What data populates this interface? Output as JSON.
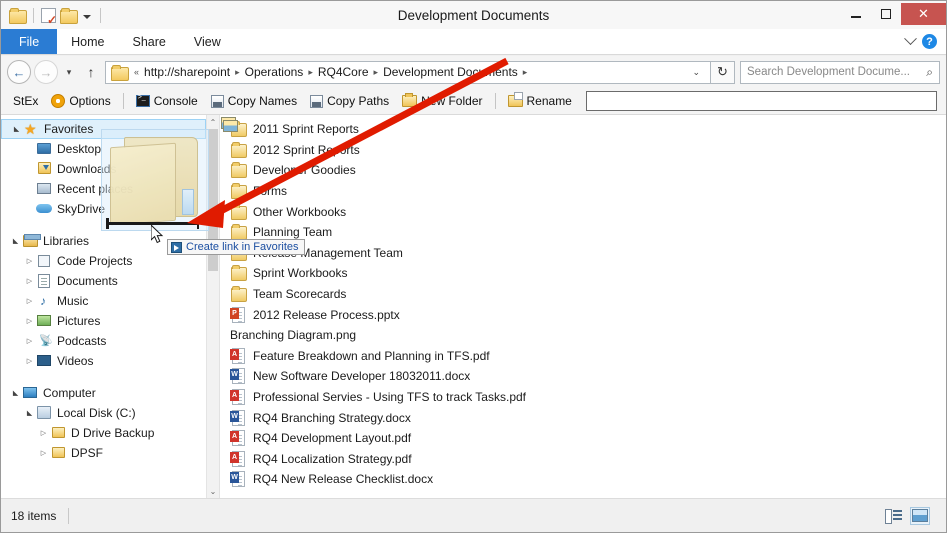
{
  "window": {
    "title": "Development Documents",
    "minimize_label": "Minimize",
    "maximize_label": "Maximize",
    "close_label": "✕"
  },
  "quick_access": {
    "folder_icon": "folder-icon",
    "properties_icon": "properties-icon",
    "new_folder_icon": "new-folder-icon",
    "dropdown_icon": "chevron-down-icon"
  },
  "ribbon": {
    "tabs": [
      {
        "label": "File",
        "active": true
      },
      {
        "label": "Home",
        "active": false
      },
      {
        "label": "Share",
        "active": false
      },
      {
        "label": "View",
        "active": false
      }
    ],
    "expand_icon": "chevron-down-icon",
    "help_icon": "help-icon",
    "help_glyph": "?"
  },
  "address_bar": {
    "back_glyph": "←",
    "forward_glyph": "→",
    "history_glyph": "▾",
    "up_glyph": "↑",
    "folder_icon": "folder-icon",
    "prefix": "«",
    "breadcrumbs": [
      "http://sharepoint",
      "Operations",
      "RQ4Core",
      "Development Documents"
    ],
    "separator": "▸",
    "dropdown_glyph": "⌄",
    "refresh_glyph": "↻"
  },
  "search": {
    "placeholder": "Search Development Docume...",
    "icon": "search-icon",
    "glyph": "⌕"
  },
  "toolbar": {
    "items": [
      {
        "label": "StEx",
        "icon": "none"
      },
      {
        "label": "Options",
        "icon": "gear-icon"
      },
      {
        "label": "Console",
        "icon": "console-icon"
      },
      {
        "label": "Copy Names",
        "icon": "copy-names-icon"
      },
      {
        "label": "Copy Paths",
        "icon": "copy-paths-icon"
      },
      {
        "label": "New Folder",
        "icon": "new-folder-icon"
      },
      {
        "label": "Rename",
        "icon": "rename-icon"
      }
    ],
    "input_value": "",
    "input_placeholder": ""
  },
  "sidebar": {
    "items": [
      {
        "label": "Favorites",
        "indent": 0,
        "expander": "open",
        "icon": "star-icon",
        "selected": true
      },
      {
        "label": "Desktop",
        "indent": 1,
        "expander": "none",
        "icon": "desktop-icon",
        "selected": false
      },
      {
        "label": "Downloads",
        "indent": 1,
        "expander": "none",
        "icon": "downloads-icon",
        "selected": false
      },
      {
        "label": "Recent places",
        "indent": 1,
        "expander": "none",
        "icon": "recent-places-icon",
        "selected": false
      },
      {
        "label": "SkyDrive",
        "indent": 1,
        "expander": "none",
        "icon": "skydrive-icon",
        "selected": false
      },
      {
        "label": "Libraries",
        "indent": 0,
        "expander": "open",
        "icon": "libraries-icon",
        "selected": false,
        "spacer_before": true
      },
      {
        "label": "Code Projects",
        "indent": 1,
        "expander": "closed",
        "icon": "code-projects-icon",
        "selected": false
      },
      {
        "label": "Documents",
        "indent": 1,
        "expander": "closed",
        "icon": "documents-icon",
        "selected": false
      },
      {
        "label": "Music",
        "indent": 1,
        "expander": "closed",
        "icon": "music-icon",
        "selected": false
      },
      {
        "label": "Pictures",
        "indent": 1,
        "expander": "closed",
        "icon": "pictures-icon",
        "selected": false
      },
      {
        "label": "Podcasts",
        "indent": 1,
        "expander": "closed",
        "icon": "podcasts-icon",
        "selected": false
      },
      {
        "label": "Videos",
        "indent": 1,
        "expander": "closed",
        "icon": "videos-icon",
        "selected": false
      },
      {
        "label": "Computer",
        "indent": 0,
        "expander": "open",
        "icon": "computer-icon",
        "selected": false,
        "spacer_before": true
      },
      {
        "label": "Local Disk (C:)",
        "indent": 1,
        "expander": "open",
        "icon": "disk-icon",
        "selected": false
      },
      {
        "label": "D Drive Backup",
        "indent": 2,
        "expander": "closed",
        "icon": "folder-icon",
        "selected": false
      },
      {
        "label": "DPSF",
        "indent": 2,
        "expander": "closed",
        "icon": "folder-icon",
        "selected": false
      }
    ],
    "scroll_up_glyph": "⌃",
    "scroll_down_glyph": "⌄"
  },
  "file_list": {
    "items": [
      {
        "name": "2011 Sprint Reports",
        "type": "folder"
      },
      {
        "name": "2012 Sprint Reports",
        "type": "folder"
      },
      {
        "name": "Developer Goodies",
        "type": "folder"
      },
      {
        "name": "Forms",
        "type": "folder"
      },
      {
        "name": "Other Workbooks",
        "type": "folder"
      },
      {
        "name": "Planning Team",
        "type": "folder"
      },
      {
        "name": "Release Management Team",
        "type": "folder"
      },
      {
        "name": "Sprint Workbooks",
        "type": "folder"
      },
      {
        "name": "Team Scorecards",
        "type": "folder"
      },
      {
        "name": "2012 Release Process.pptx",
        "type": "pptx"
      },
      {
        "name": "Branching Diagram.png",
        "type": "png"
      },
      {
        "name": "Feature Breakdown and Planning in TFS.pdf",
        "type": "pdf"
      },
      {
        "name": "New Software Developer 18032011.docx",
        "type": "docx"
      },
      {
        "name": "Professional Servies - Using TFS to track Tasks.pdf",
        "type": "pdf"
      },
      {
        "name": "RQ4 Branching Strategy.docx",
        "type": "docx"
      },
      {
        "name": "RQ4 Development Layout.pdf",
        "type": "pdf"
      },
      {
        "name": "RQ4 Localization Strategy.pdf",
        "type": "pdf"
      },
      {
        "name": "RQ4 New Release Checklist.docx",
        "type": "docx"
      }
    ]
  },
  "drag": {
    "tooltip_text": "Create link in Favorites",
    "tooltip_icon": "shortcut-link-icon",
    "ghost_icon": "folder-icon",
    "cursor_icon": "arrow-cursor-icon"
  },
  "annotation": {
    "arrow_color": "#e01b00",
    "arrow_icon": "red-arrow-annotation"
  },
  "status_bar": {
    "item_count": "18 items",
    "details_view_label": "Details view",
    "thumbnail_view_label": "Large icons view"
  },
  "colors": {
    "file_tab": "#2b7cd3",
    "close_button": "#c75450",
    "selection": "#dff0fb",
    "selection_border": "#9cd2f5",
    "link_text": "#1c4fa1"
  }
}
